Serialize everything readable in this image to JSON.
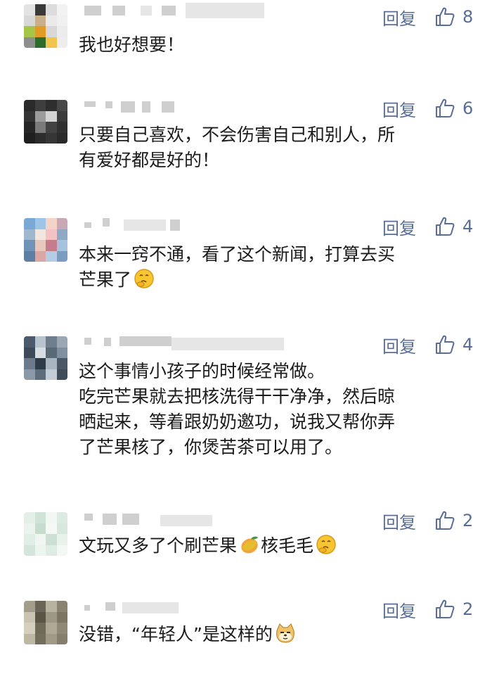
{
  "comments": [
    {
      "reply": "回复",
      "likes": "8",
      "text": "我也好想要！",
      "avatar_colors": [
        "#e3e3e3",
        "#3a3a3a",
        "#dcdcdc",
        "#f2f2f2",
        "#d8d8d8",
        "#c7b08a",
        "#eaeaea",
        "#f0f0f0",
        "#a6c64a",
        "#e29b25",
        "#d8d8d8",
        "#ececec",
        "#8e8e8e",
        "#2c6b2a",
        "#f0c44d",
        "#ededed"
      ]
    },
    {
      "reply": "回复",
      "likes": "6",
      "text": "只要自己喜欢，不会伤害自己和别人，所\n有爱好都是好的！",
      "avatar_colors": [
        "#2a2a2a",
        "#3e3e3e",
        "#2e2e2e",
        "#474747",
        "#353535",
        "#9c9c9c",
        "#d4d4d4",
        "#3a3a3a",
        "#262626",
        "#7a7a7a",
        "#424242",
        "#303030",
        "#1f1f1f",
        "#2c2c2c",
        "#363636",
        "#2a2a2a"
      ]
    },
    {
      "reply": "回复",
      "likes": "4",
      "text": "本来一窍不通，看了这个新闻，打算去买\n芒果了",
      "emoji": "think",
      "avatar_colors": [
        "#7aa8d4",
        "#9ec4e8",
        "#f4d4c8",
        "#c9a7b4",
        "#9eb8cf",
        "#f1e6e0",
        "#f4c2c2",
        "#8ea9c5",
        "#6f94b8",
        "#e8c7bd",
        "#c57c8c",
        "#a6c2de",
        "#5c7fa3",
        "#dba6a6",
        "#b5cde4",
        "#7a9cc0"
      ]
    },
    {
      "reply": "回复",
      "likes": "4",
      "text": "这个事情小孩子的时候经常做。\n吃完芒果就去把核洗得干干净净，然后晾\n晒起来，等着跟奶奶邀功，说我又帮你弄\n了芒果核了，你煲苦茶可以用了。",
      "avatar_colors": [
        "#4b5a6c",
        "#b7c4cf",
        "#6f7e8c",
        "#9aa8b4",
        "#3c4a59",
        "#d6dee4",
        "#5a6978",
        "#8090a0",
        "#6b7b8b",
        "#2e3b48",
        "#a8b6c2",
        "#4a5866",
        "#8b99a6",
        "#5e6d7c",
        "#c2cdd6",
        "#3f4d5b"
      ]
    },
    {
      "reply": "回复",
      "likes": "2",
      "text": "文玩又多了个刷芒果",
      "text2": "核毛毛",
      "emoji": "mango",
      "emoji2": "think",
      "avatar_colors": [
        "#e4efe8",
        "#cfe3d6",
        "#f2f7f3",
        "#dcebe1",
        "#eaf3ed",
        "#c7dccd",
        "#f5f9f6",
        "#d9e8de",
        "#e1eee5",
        "#f0f6f2",
        "#cde0d3",
        "#e8f2eb",
        "#d4e6da",
        "#edf5ef",
        "#dfece3",
        "#f3f8f4"
      ]
    },
    {
      "reply": "回复",
      "likes": "2",
      "text": "没错，“年轻人”是这样的",
      "emoji": "doge",
      "avatar_colors": [
        "#a39d8c",
        "#6b6558",
        "#b8b2a0",
        "#8a8372",
        "#c9c3b1",
        "#5a5446",
        "#9d9785",
        "#7c7563",
        "#d4cfbe",
        "#6f6957",
        "#aea894",
        "#8f8876",
        "#bdb7a4",
        "#736d5b",
        "#a09a87",
        "#857e6c"
      ]
    }
  ]
}
